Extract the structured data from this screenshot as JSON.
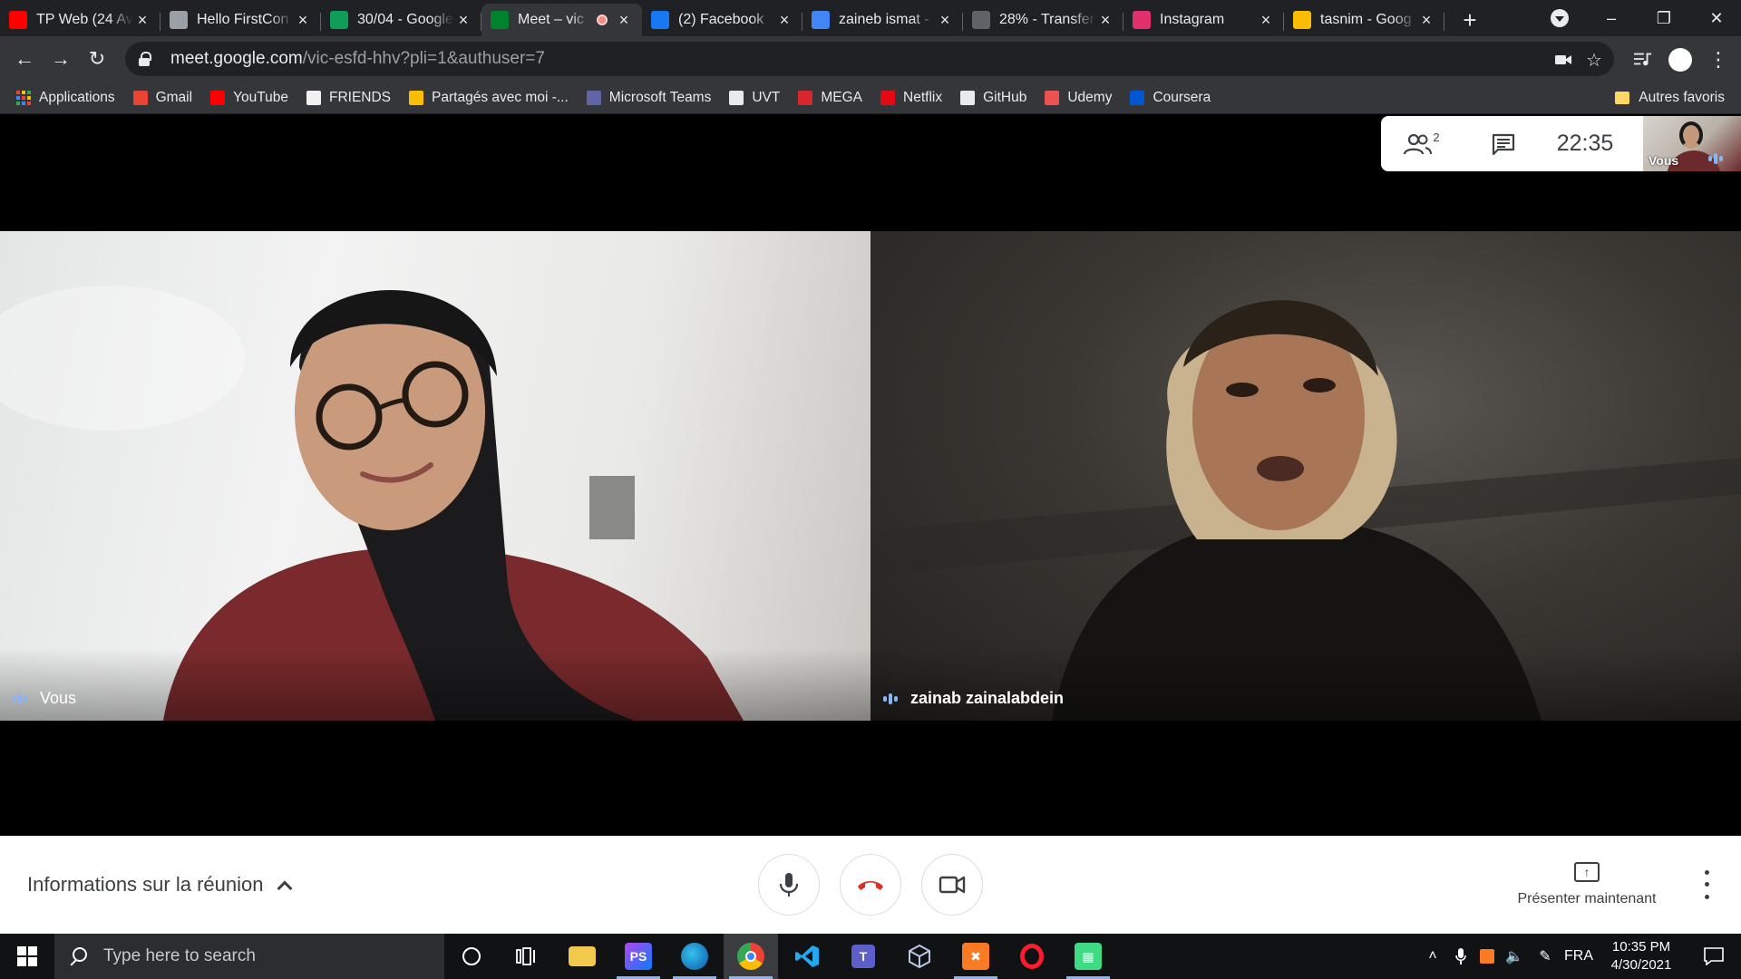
{
  "browser": {
    "tabs": [
      {
        "title": "TP Web (24 Av",
        "favicon": "youtube-icon",
        "color": "#ff0000",
        "active": false
      },
      {
        "title": "Hello FirstCon",
        "favicon": "globe-icon",
        "color": "#9aa0a6",
        "active": false
      },
      {
        "title": "30/04 - Google",
        "favicon": "google-sheets-icon",
        "color": "#0f9d58",
        "active": false
      },
      {
        "title": "Meet – vic",
        "favicon": "google-meet-icon",
        "color": "#00832d",
        "active": true,
        "recording": true
      },
      {
        "title": "(2) Facebook",
        "favicon": "facebook-icon",
        "color": "#1877f2",
        "active": false
      },
      {
        "title": "zaineb ismat -",
        "favicon": "google-docs-icon",
        "color": "#4285f4",
        "active": false
      },
      {
        "title": "28% - Transfer",
        "favicon": "wetransfer-icon",
        "color": "#5f6368",
        "active": false
      },
      {
        "title": "Instagram",
        "favicon": "instagram-icon",
        "color": "#e1306c",
        "active": false
      },
      {
        "title": "tasnim - Goog",
        "favicon": "google-drive-icon",
        "color": "#fbbc04",
        "active": false
      }
    ],
    "url_host": "meet.google.com",
    "url_path": "/vic-esfd-hhv?pli=1&authuser=7"
  },
  "bookmarks": {
    "items": [
      {
        "label": "Applications",
        "icon": "apps-grid-icon"
      },
      {
        "label": "Gmail",
        "icon": "gmail-icon",
        "color": "#ea4335"
      },
      {
        "label": "YouTube",
        "icon": "youtube-icon",
        "color": "#ff0000"
      },
      {
        "label": "FRIENDS",
        "icon": "friends-icon",
        "color": "#f1f1f1"
      },
      {
        "label": "Partagés avec moi -...",
        "icon": "google-drive-icon",
        "color": "#fbbc04"
      },
      {
        "label": "Microsoft Teams",
        "icon": "teams-icon",
        "color": "#6264a7"
      },
      {
        "label": "UVT",
        "icon": "uvt-icon",
        "color": "#e8eaed"
      },
      {
        "label": "MEGA",
        "icon": "mega-icon",
        "color": "#d9272e"
      },
      {
        "label": "Netflix",
        "icon": "netflix-icon",
        "color": "#e50914"
      },
      {
        "label": "GitHub",
        "icon": "github-icon",
        "color": "#e8eaed"
      },
      {
        "label": "Udemy",
        "icon": "udemy-icon",
        "color": "#ec5252"
      },
      {
        "label": "Coursera",
        "icon": "coursera-icon",
        "color": "#0056d2"
      }
    ],
    "other_label": "Autres favoris"
  },
  "meet": {
    "participant_count": "2",
    "clock": "22:35",
    "self_thumb_label": "Vous",
    "tiles": [
      {
        "name": "Vous"
      },
      {
        "name": "zainab zainalabdein"
      }
    ],
    "meeting_info_label": "Informations sur la réunion",
    "present_label": "Présenter maintenant",
    "accent_color": "#8ab4f8",
    "hangup_color": "#d93025"
  },
  "taskbar": {
    "search_placeholder": "Type here to search",
    "language": "FRA",
    "time": "10:35 PM",
    "date": "4/30/2021"
  }
}
